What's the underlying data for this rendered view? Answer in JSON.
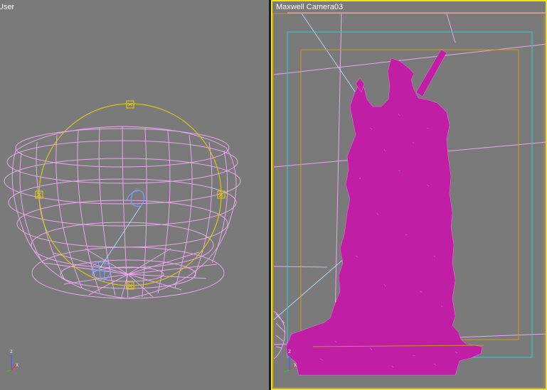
{
  "viewports": {
    "left": {
      "label": "User"
    },
    "right": {
      "label": "Maxwell Camera03"
    }
  },
  "axis": {
    "x": "x",
    "z": "z"
  },
  "colors": {
    "viewport_bg": "#7a7a7a",
    "active_border": "#f2e600",
    "wireframe_dome": "#e9a6ef",
    "light_gizmo": "#d8c41c",
    "model_fill": "#c01ea4",
    "safe_frame_outer": "#3fc3c6",
    "safe_frame_inner": "#c89428"
  }
}
